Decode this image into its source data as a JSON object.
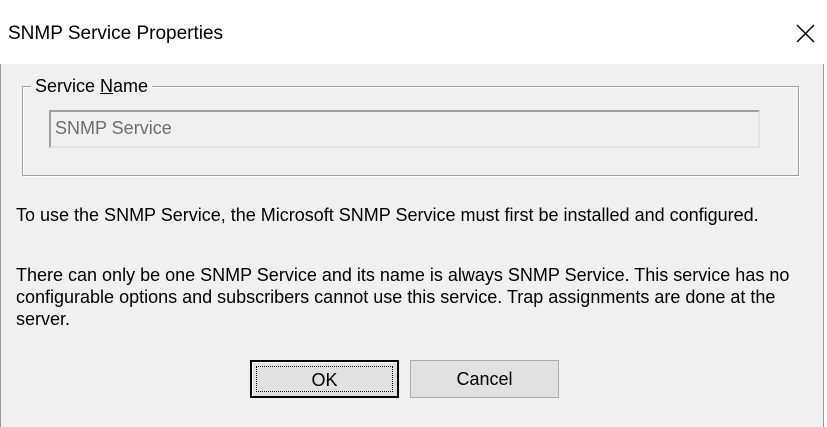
{
  "window": {
    "title": "SNMP Service Properties",
    "close_icon": "close-icon"
  },
  "group": {
    "legend_prefix": "Service ",
    "legend_mnemonic": "N",
    "legend_suffix": "ame",
    "field_value": "SNMP Service"
  },
  "body": {
    "paragraph1": "To use the SNMP Service, the Microsoft SNMP Service must first be installed and configured.",
    "paragraph2": "There can only be one SNMP Service and its name is always SNMP Service. This service has no configurable options and subscribers cannot use this service. Trap assignments are done at the server."
  },
  "buttons": {
    "ok_label": "OK",
    "cancel_label": "Cancel"
  }
}
